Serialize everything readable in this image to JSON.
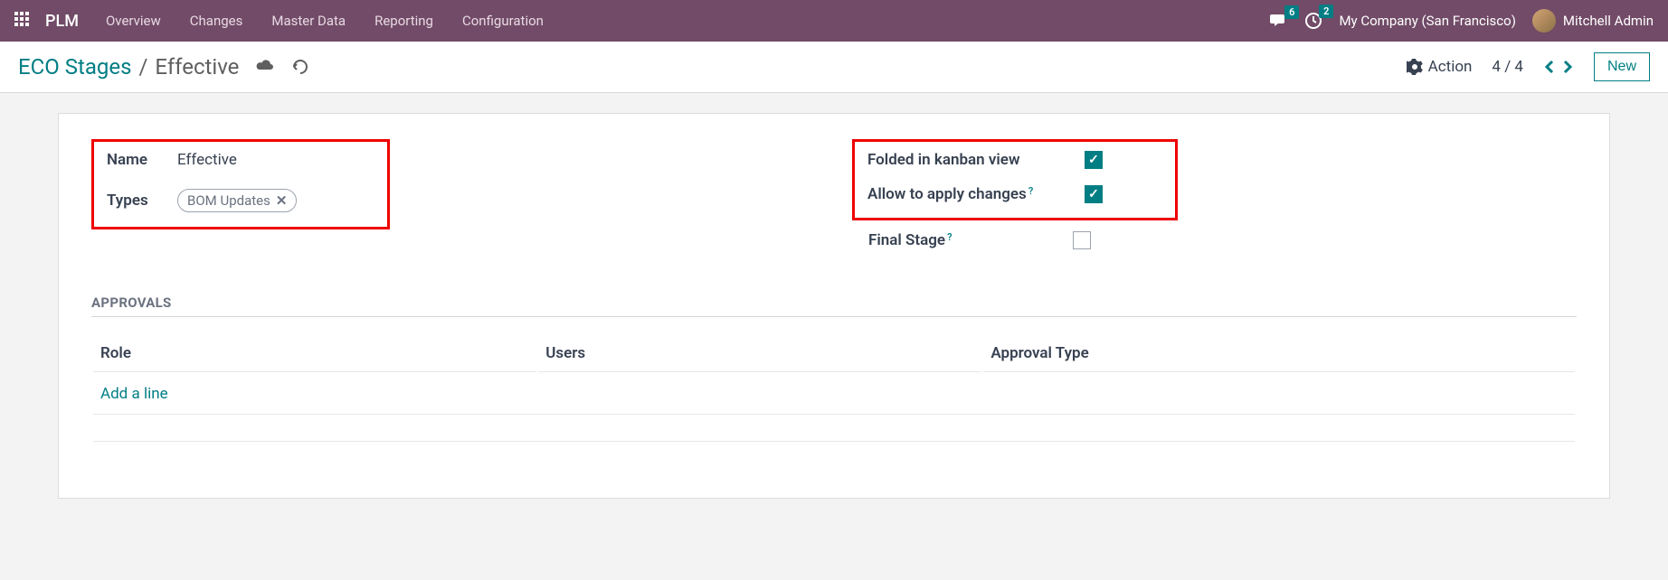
{
  "nav": {
    "brand": "PLM",
    "items": [
      "Overview",
      "Changes",
      "Master Data",
      "Reporting",
      "Configuration"
    ],
    "messages_badge": "6",
    "activities_badge": "2",
    "company": "My Company (San Francisco)",
    "user": "Mitchell Admin"
  },
  "control": {
    "breadcrumb_root": "ECO Stages",
    "breadcrumb_sep": "/",
    "breadcrumb_current": "Effective",
    "action_label": "Action",
    "pager": "4 / 4",
    "new_label": "New"
  },
  "form": {
    "name_label": "Name",
    "name_value": "Effective",
    "types_label": "Types",
    "types_tag": "BOM Updates",
    "folded_label": "Folded in kanban view",
    "apply_label": "Allow to apply changes",
    "final_label": "Final Stage",
    "folded_checked": true,
    "apply_checked": true,
    "final_checked": false
  },
  "approvals": {
    "title": "APPROVALS",
    "col_role": "Role",
    "col_users": "Users",
    "col_type": "Approval Type",
    "add_line": "Add a line"
  }
}
